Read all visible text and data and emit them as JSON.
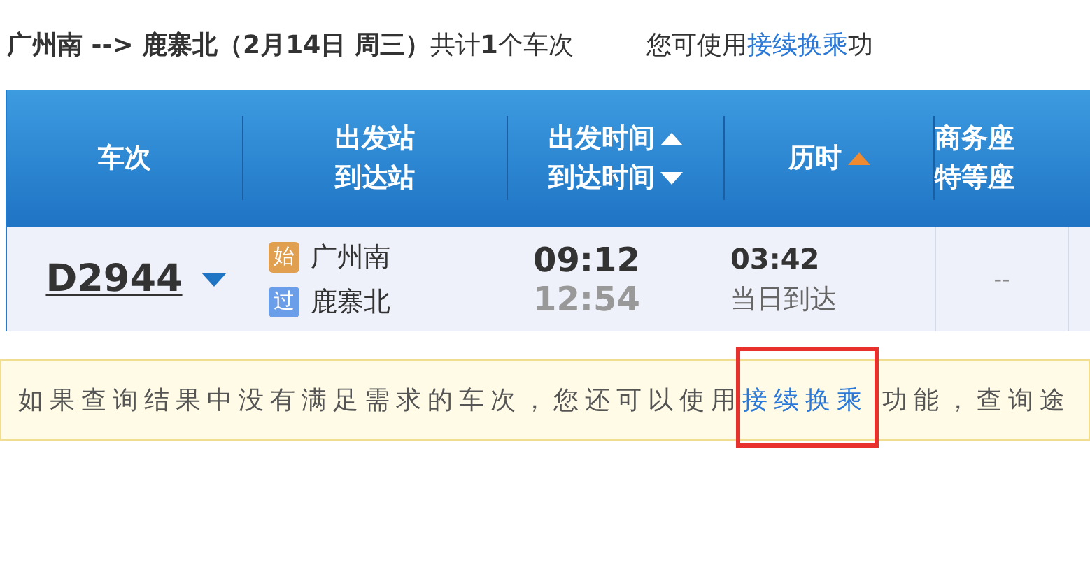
{
  "summary": {
    "text": "**广州南 --> 鹿寨北（2月14日  周三）**共计**1**个车次",
    "hint_before": "您可使用",
    "hint_link": "接续换乘",
    "hint_after": "功"
  },
  "table": {
    "columns": [
      {
        "lines": [
          {
            "text": "车次"
          }
        ]
      },
      {
        "lines": [
          {
            "text": "出发站"
          },
          {
            "text": "到达站"
          }
        ]
      },
      {
        "lines": [
          {
            "text": "出发时间",
            "ascending": true
          },
          {
            "text": "到达时间",
            "ascending": false
          }
        ],
        "sorted": false
      },
      {
        "lines": [
          {
            "text": "历时",
            "ascending": true
          }
        ],
        "sorted": true
      },
      {
        "lines": [
          {
            "text": "商务座"
          },
          {
            "text": "特等座"
          }
        ]
      }
    ],
    "rows": [
      {
        "train": "D2944",
        "from_badge": "始",
        "from": "广州南",
        "to_badge": "过",
        "to": "鹿寨北",
        "depart": "09:12",
        "arrive": "12:54",
        "duration": "03:42",
        "arrival_day": "当日到达",
        "business": "--"
      }
    ]
  },
  "notice": {
    "before": "如果查询结果中没有满足需求的车次，您还可以使用",
    "link": "接续换乘",
    "after": " 功能，查询途"
  }
}
